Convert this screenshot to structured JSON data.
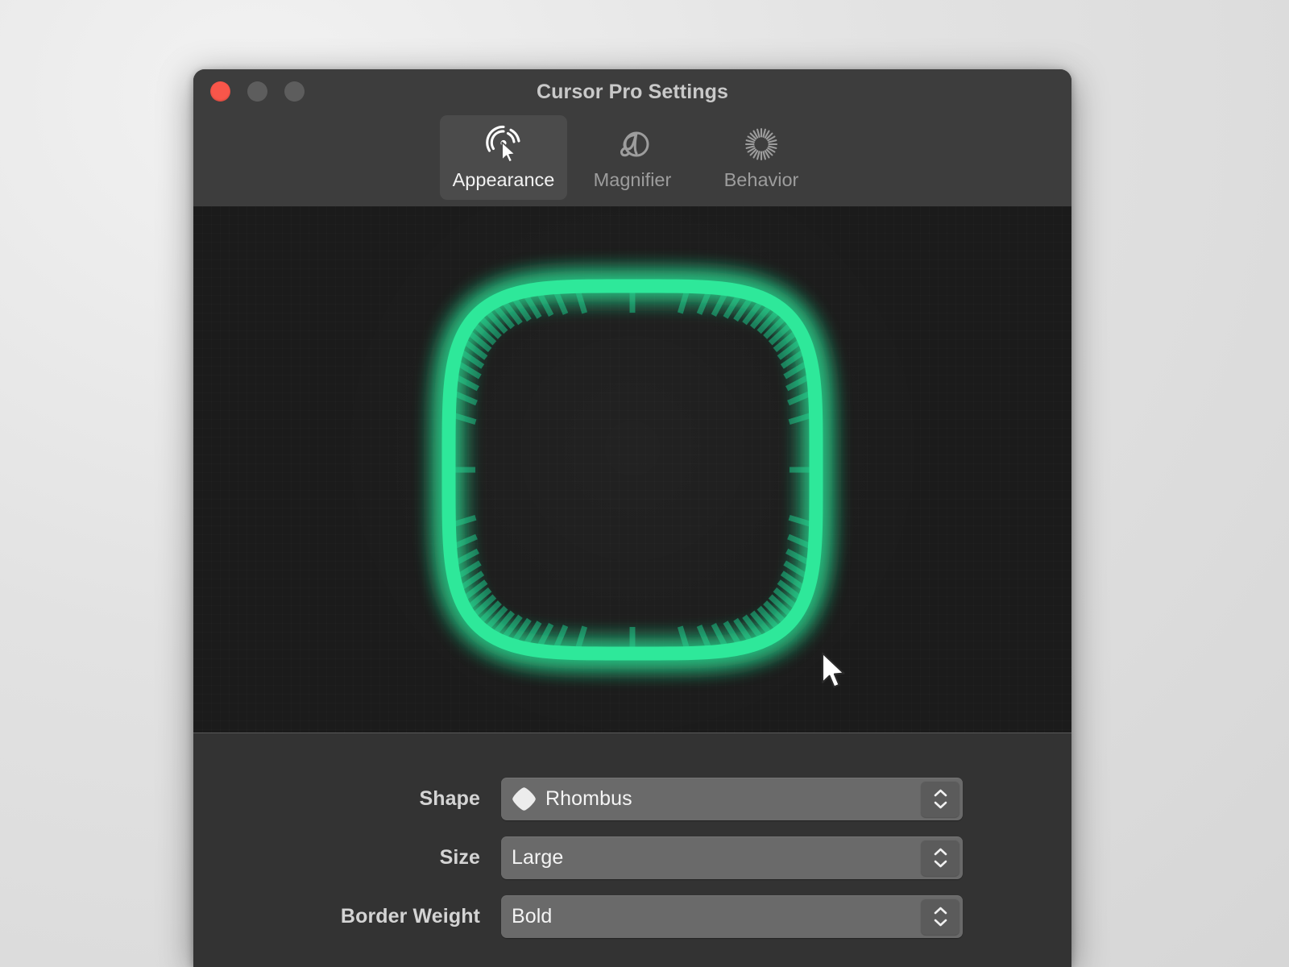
{
  "window": {
    "title": "Cursor Pro Settings",
    "traffic_lights": [
      {
        "name": "close",
        "color": "#f8564a"
      },
      {
        "name": "minimize",
        "color": "#5d5d5d"
      },
      {
        "name": "maximize",
        "color": "#5d5d5d"
      }
    ]
  },
  "toolbar": {
    "tabs": [
      {
        "label": "Appearance",
        "icon": "cursor-click-icon",
        "selected": true
      },
      {
        "label": "Magnifier",
        "icon": "accessibility-a-icon",
        "selected": false
      },
      {
        "label": "Behavior",
        "icon": "radial-burst-icon",
        "selected": false
      }
    ]
  },
  "preview": {
    "shape": "rhombus",
    "ring_color": "#2EE89A",
    "tick_color": "#1f7a5a",
    "background_color": "#1b1b1b",
    "cursor": "arrow-pointer",
    "tick_count": 72
  },
  "form": {
    "rows": [
      {
        "label": "Shape",
        "value": "Rhombus",
        "glyph": "rhombus-swatch-icon",
        "stepper": "up-down-stepper"
      },
      {
        "label": "Size",
        "value": "Large",
        "glyph": null,
        "stepper": "up-down-stepper"
      },
      {
        "label": "Border Weight",
        "value": "Bold",
        "glyph": null,
        "stepper": "up-down-stepper"
      }
    ]
  },
  "colors": {
    "window_chrome": "#3d3d3d",
    "form_background": "#333333",
    "select_background": "#6a6a6a",
    "accent_green": "#2EE89A"
  }
}
